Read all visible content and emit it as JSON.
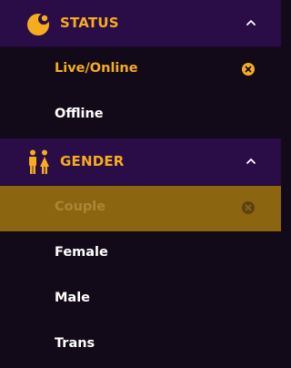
{
  "filters": {
    "status": {
      "title": "STATUS",
      "icon": "moon-status-icon",
      "items": [
        {
          "label": "Live/Online",
          "state": "active",
          "clearable": true
        },
        {
          "label": "Offline",
          "state": "normal",
          "clearable": false
        }
      ]
    },
    "gender": {
      "title": "GENDER",
      "icon": "couple-gender-icon",
      "items": [
        {
          "label": "Couple",
          "state": "selected",
          "clearable": true
        },
        {
          "label": "Female",
          "state": "normal",
          "clearable": false
        },
        {
          "label": "Male",
          "state": "normal",
          "clearable": false
        },
        {
          "label": "Trans",
          "state": "normal",
          "clearable": false
        }
      ]
    }
  },
  "colors": {
    "accent": "#f5ad1e",
    "header_bg": "#2a0c47",
    "panel_bg": "#120a18",
    "selected_bg": "#8c6510"
  }
}
